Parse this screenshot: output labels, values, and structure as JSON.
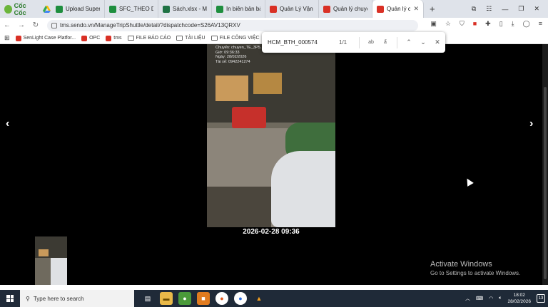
{
  "browser": {
    "brand": "Cốc Cốc",
    "tabs": [
      {
        "label": "Upload Superse",
        "color": "#1e8e3e"
      },
      {
        "label": "SFC_THEO DÕI",
        "color": "#1e8e3e"
      },
      {
        "label": "Sách.xlsx - Micr",
        "color": "#1f7244"
      },
      {
        "label": "In biên bản bàn",
        "color": "#1e8e3e"
      },
      {
        "label": "Quản Lý Vận Đơ",
        "color": "#d93025"
      },
      {
        "label": "Quản lý chuyến",
        "color": "#d93025"
      },
      {
        "label": "Quản lý ch",
        "color": "#d93025",
        "active": true
      }
    ],
    "url": "tms.sendo.vn/ManageTripShuttle/detail/?dispatchcode=S26AV13QRXV",
    "bookmarks": [
      {
        "label": "SenLight Case Platfor...",
        "type": "page",
        "color": "#d93025"
      },
      {
        "label": "OPC",
        "type": "page",
        "color": "#d93025"
      },
      {
        "label": "tms",
        "type": "page",
        "color": "#d93025"
      },
      {
        "label": "FILE BÁO CÁO",
        "type": "folder"
      },
      {
        "label": "TÀI LIỆU",
        "type": "folder"
      },
      {
        "label": "FILE CÔNG VIỆC",
        "type": "folder"
      }
    ]
  },
  "find": {
    "query": "HCM_BTH_000574",
    "count": "1/1",
    "match_case": "ab",
    "match_diacritics": "ẩ"
  },
  "viewer": {
    "photo_stamp": "Chuyến: chuyen_TE_3P5...\nGiờ: 09:36:33\nNgày: 28/02/2026\nTài xế: 0942241274",
    "caption": "2026-02-28 09:36",
    "prev": "‹",
    "next": "›"
  },
  "watermark": {
    "title": "Activate Windows",
    "subtitle": "Go to Settings to activate Windows."
  },
  "taskbar": {
    "search_placeholder": "Type here to search",
    "time": "18:02",
    "date": "28/02/2026",
    "notifications": "13"
  }
}
